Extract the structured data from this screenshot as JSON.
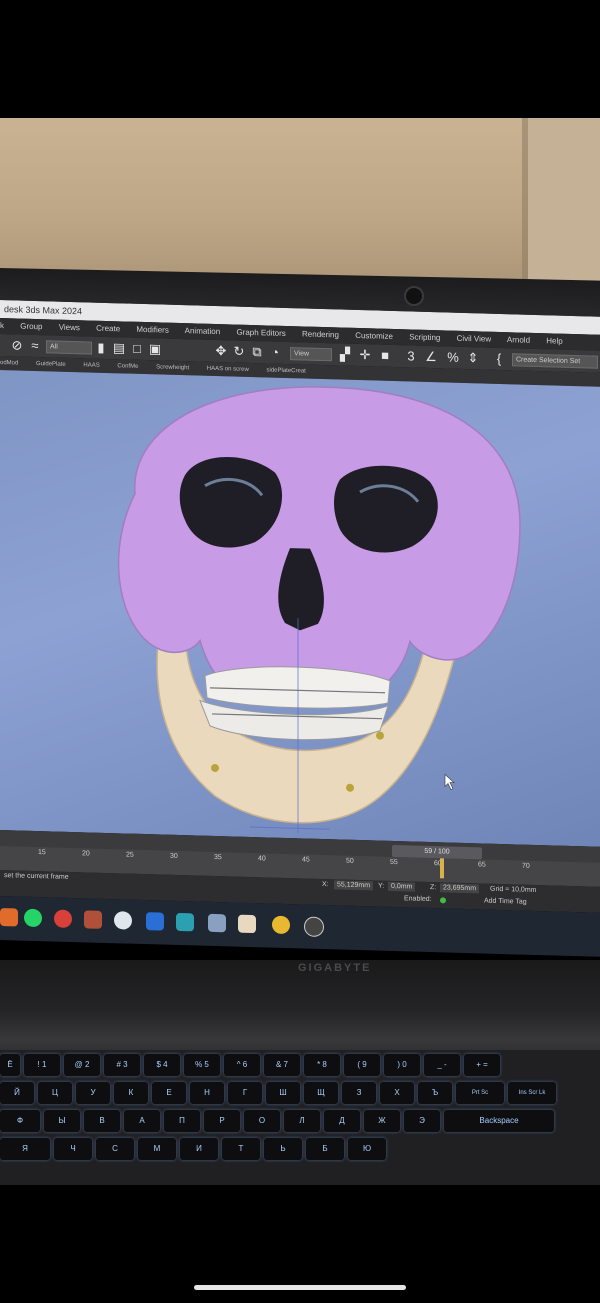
{
  "app": {
    "title": "desk 3ds Max 2024",
    "menu": [
      "k",
      "Group",
      "Views",
      "Create",
      "Modifiers",
      "Animation",
      "Graph Editors",
      "Rendering",
      "Customize",
      "Scripting",
      "Civil View",
      "Arnold",
      "Help"
    ],
    "toolbar": {
      "filter_value": "All",
      "view_value": "View",
      "selection_set": "Create Selection Set"
    },
    "ribbon": [
      "odMod",
      "GuidePlate",
      "HAAS",
      "ConfMe",
      "Screwheight",
      "HAAS on screw",
      "sidePlateCreat"
    ]
  },
  "timeline": {
    "frame_readout": "59 / 100",
    "ticks": [
      "15",
      "20",
      "25",
      "30",
      "35",
      "40",
      "45",
      "50",
      "55",
      "60",
      "65",
      "70"
    ],
    "current_fraction": 0.59
  },
  "status": {
    "prompt": "set the current frame",
    "x_label": "X:",
    "x_value": "55,129mm",
    "y_label": "Y:",
    "y_value": "0,0mm",
    "z_label": "Z:",
    "z_value": "23,695mm",
    "grid": "Grid = 10,0mm",
    "enabled_label": "Enabled:",
    "add_time_tag": "Add Time Tag"
  },
  "laptop": {
    "brand": "GIGABYTE"
  },
  "keyboard": {
    "row1": [
      "Ë",
      "! 1",
      "@ 2",
      "# 3",
      "$ 4",
      "% 5",
      "^ 6",
      "& 7",
      "* 8",
      "( 9",
      ") 0",
      "_ -",
      "+ ="
    ],
    "row2": [
      "Й",
      "Ц",
      "У",
      "К",
      "Е",
      "Н",
      "Г",
      "Ш",
      "Щ",
      "З",
      "Х",
      "Ъ",
      "Prt Sc",
      "Ins Scr Lk"
    ],
    "row3": [
      "Ф",
      "Ы",
      "В",
      "А",
      "П",
      "Р",
      "О",
      "Л",
      "Д",
      "Ж",
      "Э",
      "Backspace"
    ],
    "row4": [
      "Я",
      "Ч",
      "С",
      "М",
      "И",
      "Т",
      "Ь",
      "Б",
      "Ю"
    ]
  },
  "colors": {
    "skull": "#c79be6",
    "mandible": "#ead9bd",
    "viewport": "#8da2d3",
    "key_backlight": "#a8d0ff"
  }
}
